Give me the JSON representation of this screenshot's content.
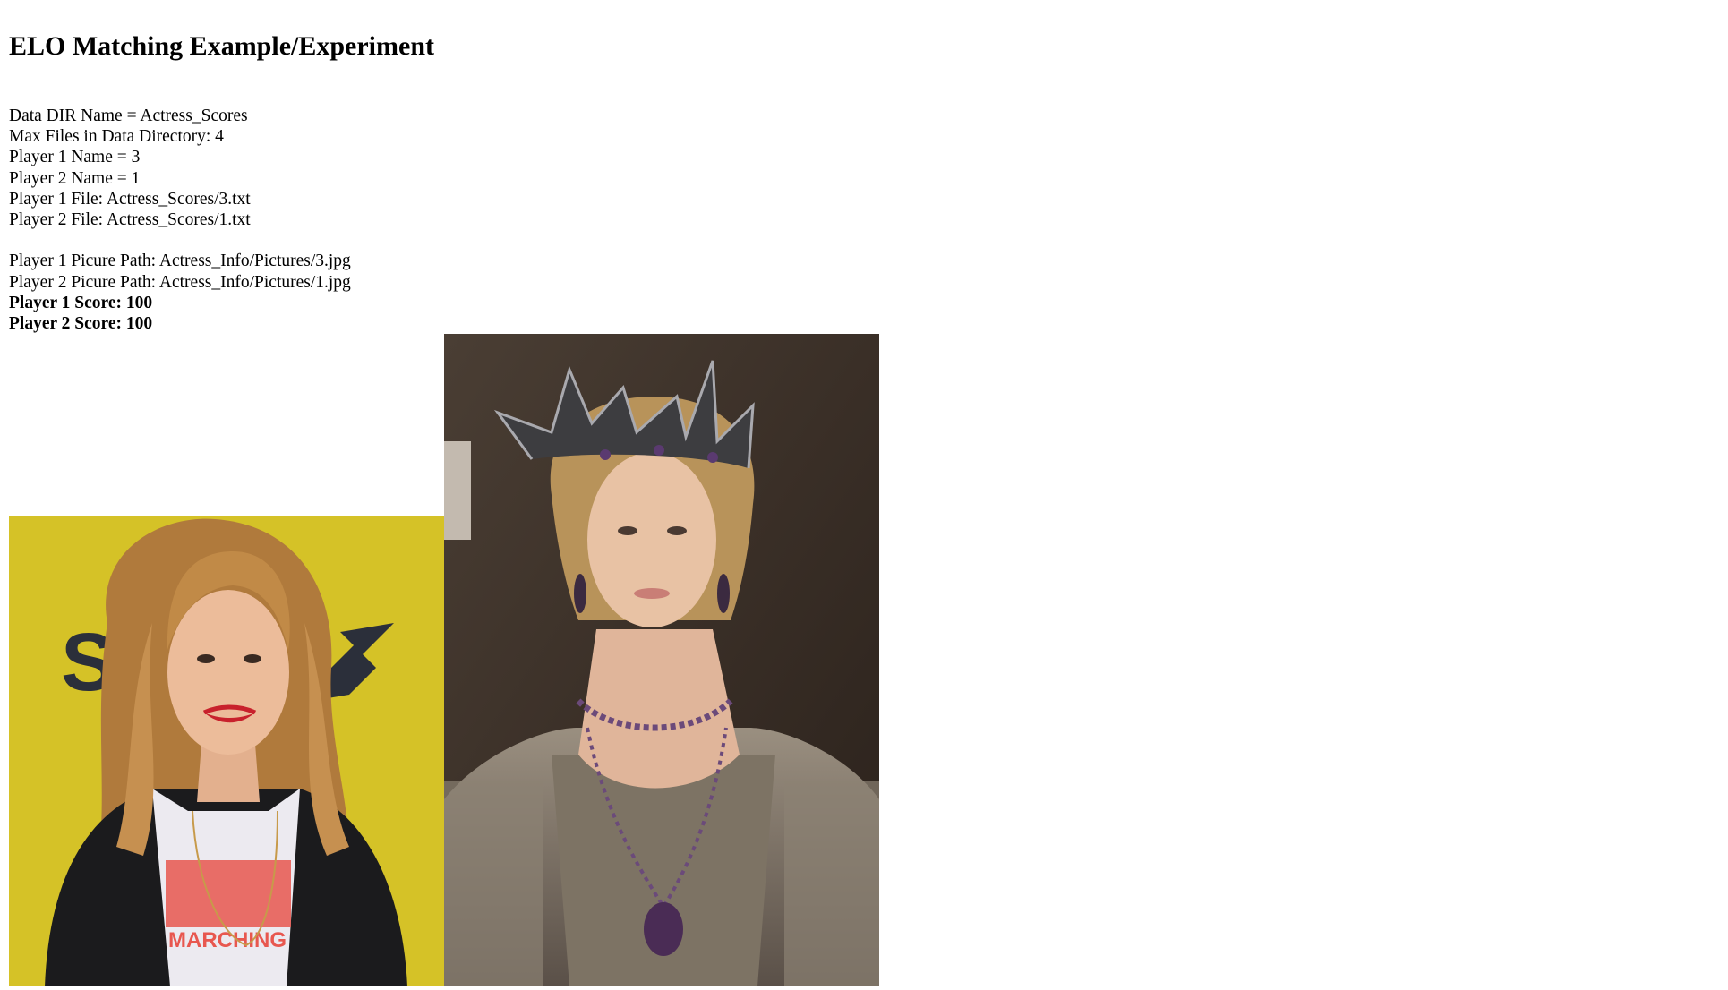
{
  "page": {
    "title": "ELO Matching Example/Experiment"
  },
  "info": {
    "data_dir": "Data DIR Name = Actress_Scores",
    "max_files": "Max Files in Data Directory: 4",
    "player1_name": "Player 1 Name = 3",
    "player2_name": "Player 2 Name = 1",
    "player1_file": "Player 1 File: Actress_Scores/3.txt",
    "player2_file": "Player 2 File: Actress_Scores/1.txt",
    "player1_picture_path": "Player 1 Picure Path: Actress_Info/Pictures/3.jpg",
    "player2_picture_path": "Player 2 Picure Path: Actress_Info/Pictures/1.jpg",
    "player1_score": "Player 1 Score: 100",
    "player2_score": "Player 2 Score: 100"
  },
  "photos": {
    "player1": {
      "backdrop_text": "SXSW",
      "shirt_text": "MARCHING",
      "background_color": "#d9c62a"
    },
    "player2": {
      "background_color": "#3a2f27"
    }
  }
}
